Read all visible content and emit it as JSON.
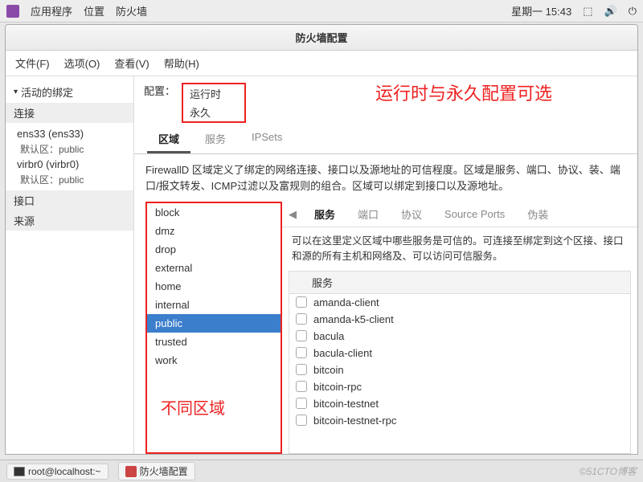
{
  "topbar": {
    "menu": [
      "应用程序",
      "位置",
      "防火墙"
    ],
    "datetime": "星期一 15:43"
  },
  "window": {
    "title": "防火墙配置",
    "menus": [
      "文件(F)",
      "选项(O)",
      "查看(V)",
      "帮助(H)"
    ]
  },
  "sidebar": {
    "active_bindings": "活动的绑定",
    "sections": {
      "connections": "连接",
      "items": [
        {
          "name": "ens33 (ens33)",
          "default": "默认区：public"
        },
        {
          "name": "virbr0 (virbr0)",
          "default": "默认区：public"
        }
      ],
      "interfaces": "接口",
      "sources": "来源"
    }
  },
  "config": {
    "label": "配置：",
    "options": [
      "运行时",
      "永久"
    ],
    "annotation": "运行时与永久配置可选"
  },
  "tabs": [
    "区域",
    "服务",
    "IPSets"
  ],
  "description": "FirewallD 区域定义了绑定的网络连接、接口以及源地址的可信程度。区域是服务、端口、协议、装、端口/报文转发、ICMP过滤以及富规则的组合。区域可以绑定到接口以及源地址。",
  "zones": [
    "block",
    "dmz",
    "drop",
    "external",
    "home",
    "internal",
    "public",
    "trusted",
    "work"
  ],
  "zone_annotation": "不同区域",
  "subtabs": [
    "服务",
    "端口",
    "协议",
    "Source Ports",
    "伪装"
  ],
  "service_desc": "可以在这里定义区域中哪些服务是可信的。可连接至绑定到这个区接、接口和源的所有主机和网络及、可以访问可信服务。",
  "service_header": "服务",
  "services": [
    "amanda-client",
    "amanda-k5-client",
    "bacula",
    "bacula-client",
    "bitcoin",
    "bitcoin-rpc",
    "bitcoin-testnet",
    "bitcoin-testnet-rpc"
  ],
  "taskbar": {
    "terminal": "root@localhost:~",
    "app": "防火墙配置",
    "watermark": "©51CTO博客"
  }
}
